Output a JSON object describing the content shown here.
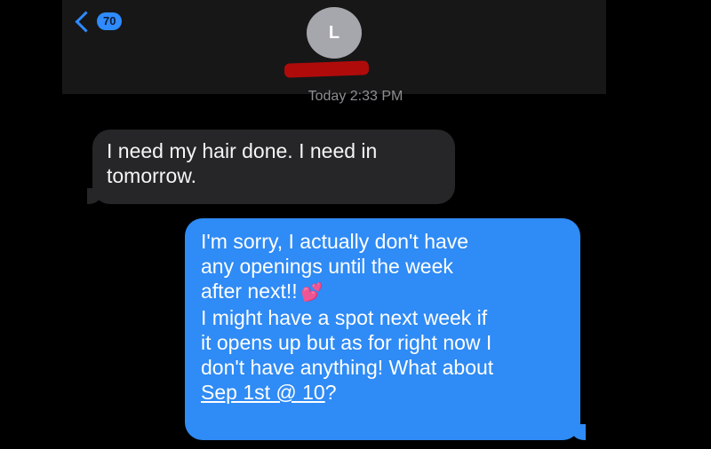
{
  "header": {
    "back_count": "70",
    "avatar_initial": "L"
  },
  "timestamp": "Today 2:33 PM",
  "messages": {
    "incoming": {
      "line1": "I need my hair done. I need in",
      "line2": "tomorrow."
    },
    "outgoing": {
      "line1": "I'm sorry, I actually don't have",
      "line2": "any openings until the week",
      "line3": "after next!!",
      "emoji": "💕",
      "line4": "I might have a spot next week if",
      "line5": "it opens up but as for right now I",
      "line6": "don't have anything! What about",
      "link": "Sep 1st @ 10",
      "after_link": "?"
    }
  },
  "colors": {
    "outgoing_bubble": "#2f8bf5",
    "incoming_bubble": "#262628",
    "accent": "#2f8bff"
  }
}
